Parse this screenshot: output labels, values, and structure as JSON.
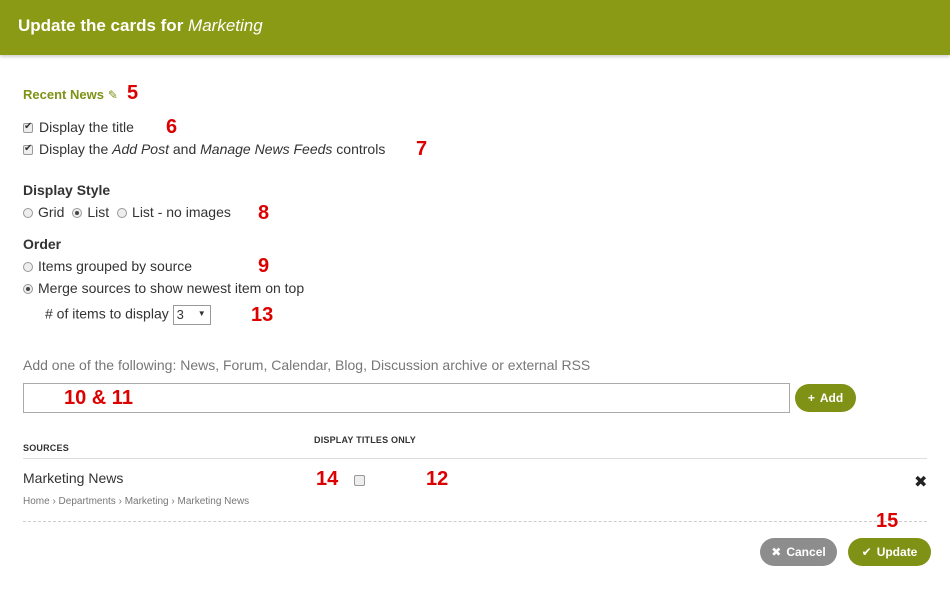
{
  "header": {
    "title_prefix": "Update the cards for ",
    "title_group": "Marketing"
  },
  "card": {
    "name": "Recent News",
    "edit_icon": "pencil-icon"
  },
  "options": {
    "display_title": {
      "label": "Display the title",
      "checked": true
    },
    "display_controls": {
      "prefix": "Display the ",
      "add_post": "Add Post",
      "and": " and ",
      "manage_feeds": "Manage News Feeds",
      "suffix": " controls",
      "checked": true
    }
  },
  "display_style": {
    "heading": "Display Style",
    "options": [
      "Grid",
      "List",
      "List - no images"
    ],
    "selected": "List"
  },
  "order": {
    "heading": "Order",
    "options": [
      "Items grouped by source",
      "Merge sources to show newest item on top"
    ],
    "selected": "Merge sources to show newest item on top",
    "items_label": "# of items to display",
    "items_value": "3"
  },
  "add_source": {
    "hint": "Add one of the following: News, Forum, Calendar, Blog, Discussion archive or external RSS",
    "input_value": "",
    "add_label": "Add",
    "add_icon": "plus-icon"
  },
  "table": {
    "col_sources": "SOURCES",
    "col_titles_only": "DISPLAY TITLES ONLY",
    "rows": [
      {
        "name": "Marketing News",
        "breadcrumb": "Home › Departments › Marketing › Marketing News",
        "titles_only": false
      }
    ]
  },
  "footer": {
    "cancel_label": "Cancel",
    "cancel_icon": "x-icon",
    "update_label": "Update",
    "update_icon": "check-icon"
  },
  "annotations": {
    "n5": "5",
    "n6": "6",
    "n7": "7",
    "n8": "8",
    "n9": "9",
    "n13": "13",
    "n10_11": "10 & 11",
    "n14": "14",
    "n12": "12",
    "n15": "15"
  },
  "colors": {
    "header": "#8a9a14",
    "accent": "#7f9215",
    "annotation": "#dd0000",
    "cancel": "#8d8d8d"
  }
}
